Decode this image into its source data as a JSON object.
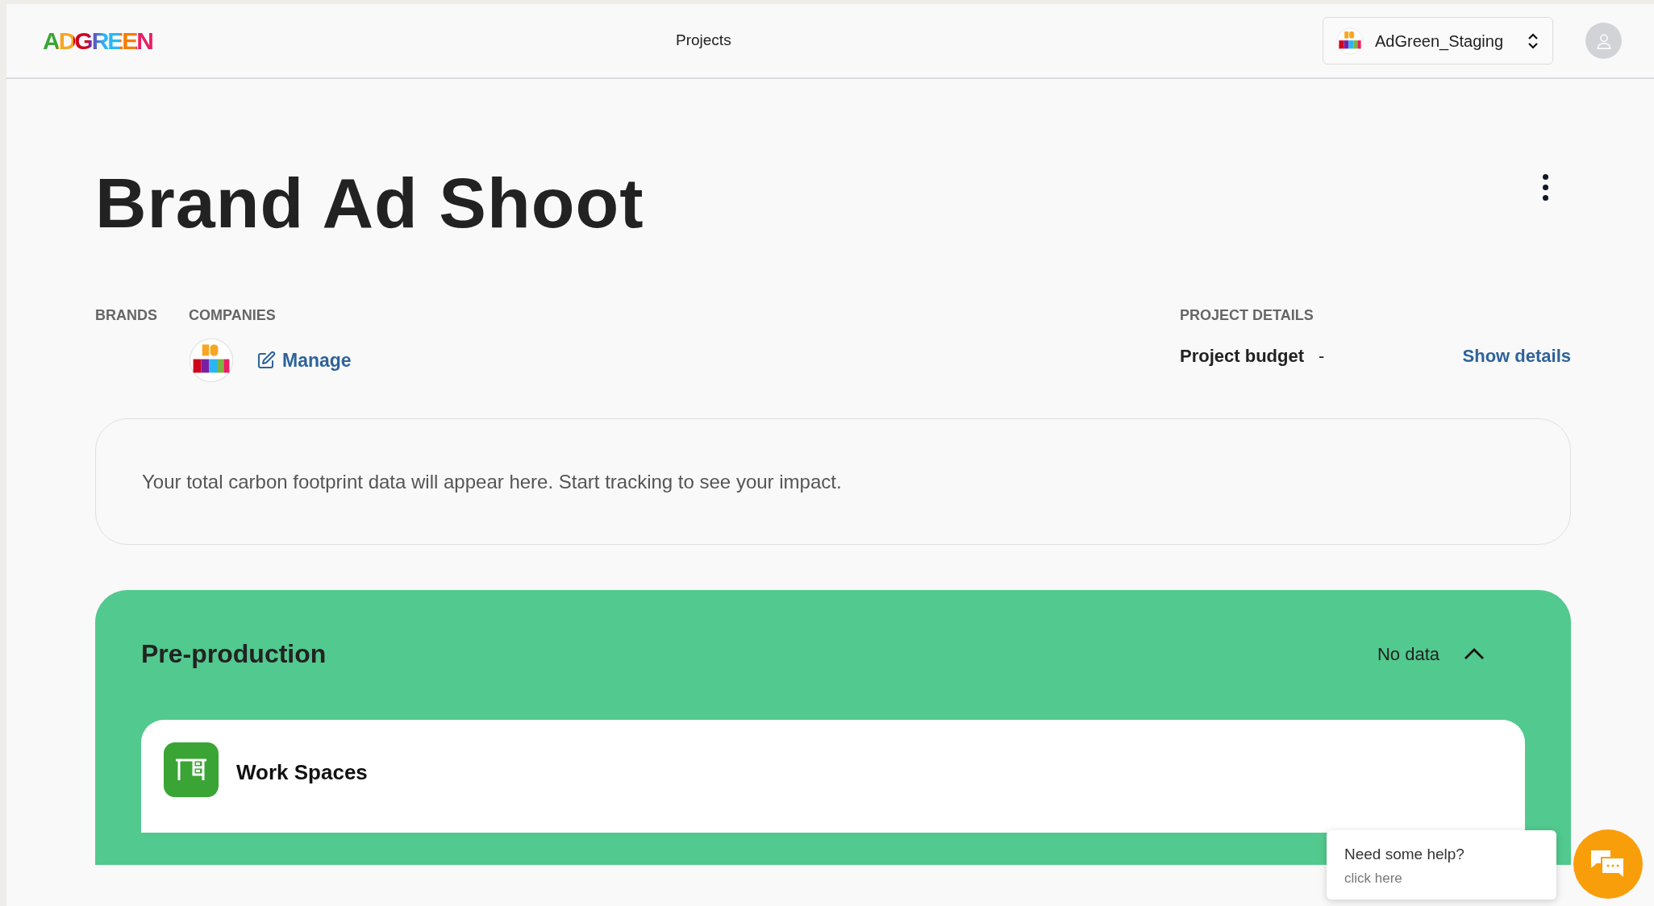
{
  "header": {
    "logo": "ADGREEN",
    "nav": "Projects",
    "workspace": "AdGreen_Staging"
  },
  "project": {
    "title": "Brand Ad Shoot"
  },
  "brands": {
    "label": "BRANDS"
  },
  "companies": {
    "label": "COMPANIES",
    "manage": "Manage"
  },
  "details": {
    "label": "PROJECT DETAILS",
    "budget_label": "Project budget",
    "budget_value": "-",
    "link": "Show details"
  },
  "footprint": {
    "message": "Your total carbon footprint data will appear here. Start tracking to see your impact."
  },
  "sections": [
    {
      "title": "Pre-production",
      "status": "No data",
      "expanded": true,
      "items": [
        {
          "label": "Work Spaces"
        }
      ]
    }
  ],
  "help": {
    "title": "Need some help?",
    "subtitle": "click here"
  }
}
